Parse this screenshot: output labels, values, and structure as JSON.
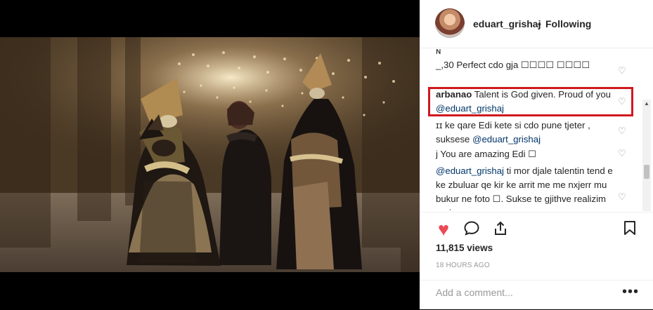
{
  "header": {
    "username": "eduart_grishaj",
    "separator": "•",
    "follow_status": "Following"
  },
  "comments": [
    {
      "author": "",
      "text": "ɴ",
      "mention": "",
      "liked": false
    },
    {
      "author": "",
      "text": "_,30 Perfect cdo gja ☐☐☐☐ ☐☐☐☐",
      "mention": "",
      "liked": false
    },
    {
      "author": "arbanao",
      "text": "Talent is God given. Proud of you",
      "mention": "@eduart_grishaj",
      "liked": false
    },
    {
      "author": "",
      "text": "ɪɪ ke qare Edi kete si cdo pune tjeter , suksese",
      "mention": "@eduart_grishaj",
      "liked": false
    },
    {
      "author": "",
      "text": "j You are amazing Edi ☐",
      "mention": "",
      "liked": false
    },
    {
      "author": "",
      "text": "ti mor djale talentin tend e ke zbuluar qe kir ke arrit me me nxjerr mu bukur ne foto ☐. Sukse te gjithve realizim prej",
      "mention": "@eduart_grishaj",
      "liked": false
    }
  ],
  "actions": {
    "like": "liked",
    "comment": "comment",
    "share": "share",
    "save": "save"
  },
  "stats": {
    "views": "11,815 views",
    "timestamp": "18 HOURS AGO"
  },
  "composer": {
    "placeholder": "Add a comment...",
    "more": "•••"
  },
  "colors": {
    "liked": "#ed4956",
    "mention": "#003569",
    "highlight": "#d0181f"
  }
}
